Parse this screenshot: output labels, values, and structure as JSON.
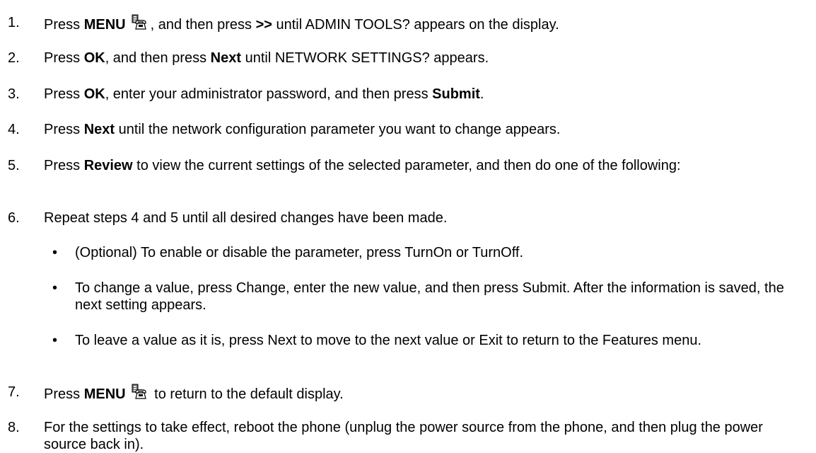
{
  "steps": [
    {
      "num": "1.",
      "t0": "Press ",
      "b0": "MENU",
      "t1": ", and then press ",
      "b1": ">>",
      "t2": " until ADMIN TOOLS? appears on the display."
    },
    {
      "num": "2.",
      "t0": "Press ",
      "b0": "OK",
      "t1": ", and then press ",
      "b1": "Next",
      "t2": " until NETWORK SETTINGS? appears."
    },
    {
      "num": "3.",
      "t0": "Press ",
      "b0": "OK",
      "t1": ", enter your administrator password, and then press ",
      "b1": "Submit",
      "t2": "."
    },
    {
      "num": "4.",
      "t0": "Press ",
      "b0": "Next",
      "t1": " until the network configuration parameter you want to change appears."
    },
    {
      "num": "5.",
      "t0": "Press ",
      "b0": "Review",
      "t1": " to view the current settings of the selected parameter, and then do one of the following:"
    },
    {
      "num": "6.",
      "t0": "Repeat steps 4 and 5 until all desired changes have been made."
    },
    {
      "num": "7.",
      "t0": "Press ",
      "b0": "MENU",
      "t1": " to return to the default display."
    },
    {
      "num": "8.",
      "t0": "For the settings to take effect, reboot the phone (unplug the power source from the phone, and then plug the power source back in)."
    }
  ],
  "bullets": [
    "(Optional) To enable or disable the parameter, press TurnOn or TurnOff.",
    "To change a value, press Change, enter the new value, and then press Submit. After the information is saved, the next setting appears.",
    "To leave a value as it is, press Next to move to the next value or Exit to return to the Features menu."
  ],
  "bullet_glyph": "•",
  "icons": [
    "menu-phone-icon"
  ]
}
